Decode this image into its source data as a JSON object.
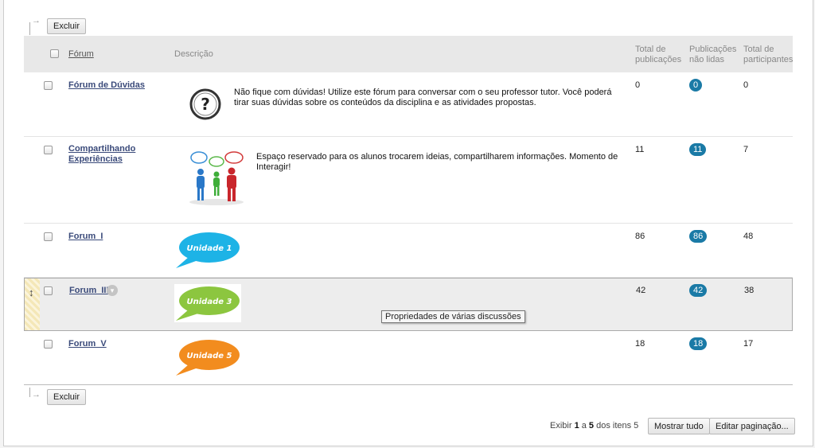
{
  "actions": {
    "delete_label": "Excluir"
  },
  "table": {
    "headers": {
      "forum": "Fórum",
      "description": "Descrição",
      "total_posts_1": "Total de",
      "total_posts_2": "publicações",
      "unread_posts_1": "Publicações",
      "unread_posts_2": "não lidas",
      "participants_1": "Total de",
      "participants_2": "participantes"
    },
    "rows": [
      {
        "name": "Fórum de Dúvidas",
        "desc_line1": "Não fique com dúvidas! Utilize este fórum para conversar com o seu professor tutor. Você poderá",
        "desc_line2": "tirar suas dúvidas sobre os conteúdos da disciplina e as atividades propostas.",
        "image": "question-mark-icon",
        "total": "0",
        "unread": "0",
        "participants": "0"
      },
      {
        "name_line1": "Compartilhando",
        "name_line2": "Experiências",
        "desc_line1": "Espaço reservado para os alunos trocarem ideias, compartilharem informações. Momento de",
        "desc_line2": "Interagir!",
        "image": "people-talking-illustration",
        "total": "11",
        "unread": "11",
        "participants": "7"
      },
      {
        "name": "Forum_I",
        "image_text": "Unidade 1",
        "image_color": "#1db3e6",
        "total": "86",
        "unread": "86",
        "participants": "48"
      },
      {
        "name": "Forum_III",
        "image_text": "Unidade 3",
        "image_color": "#8cc63f",
        "total": "42",
        "unread": "42",
        "participants": "38"
      },
      {
        "name": "Forum_V",
        "image_text": "Unidade 5",
        "image_color": "#f28c1e",
        "total": "18",
        "unread": "18",
        "participants": "17"
      }
    ]
  },
  "tooltip": "Propriedades de várias discussões",
  "pagination": {
    "prefix": "Exibir ",
    "from": "1",
    "middle": " a ",
    "to": "5",
    "suffix": " dos itens 5",
    "show_all_label": "Mostrar tudo",
    "edit_paging_label": "Editar paginação..."
  },
  "colors": {
    "badge": "#1a7aa6",
    "link": "#3a4a7a",
    "header_bg": "#e8e8e8"
  }
}
